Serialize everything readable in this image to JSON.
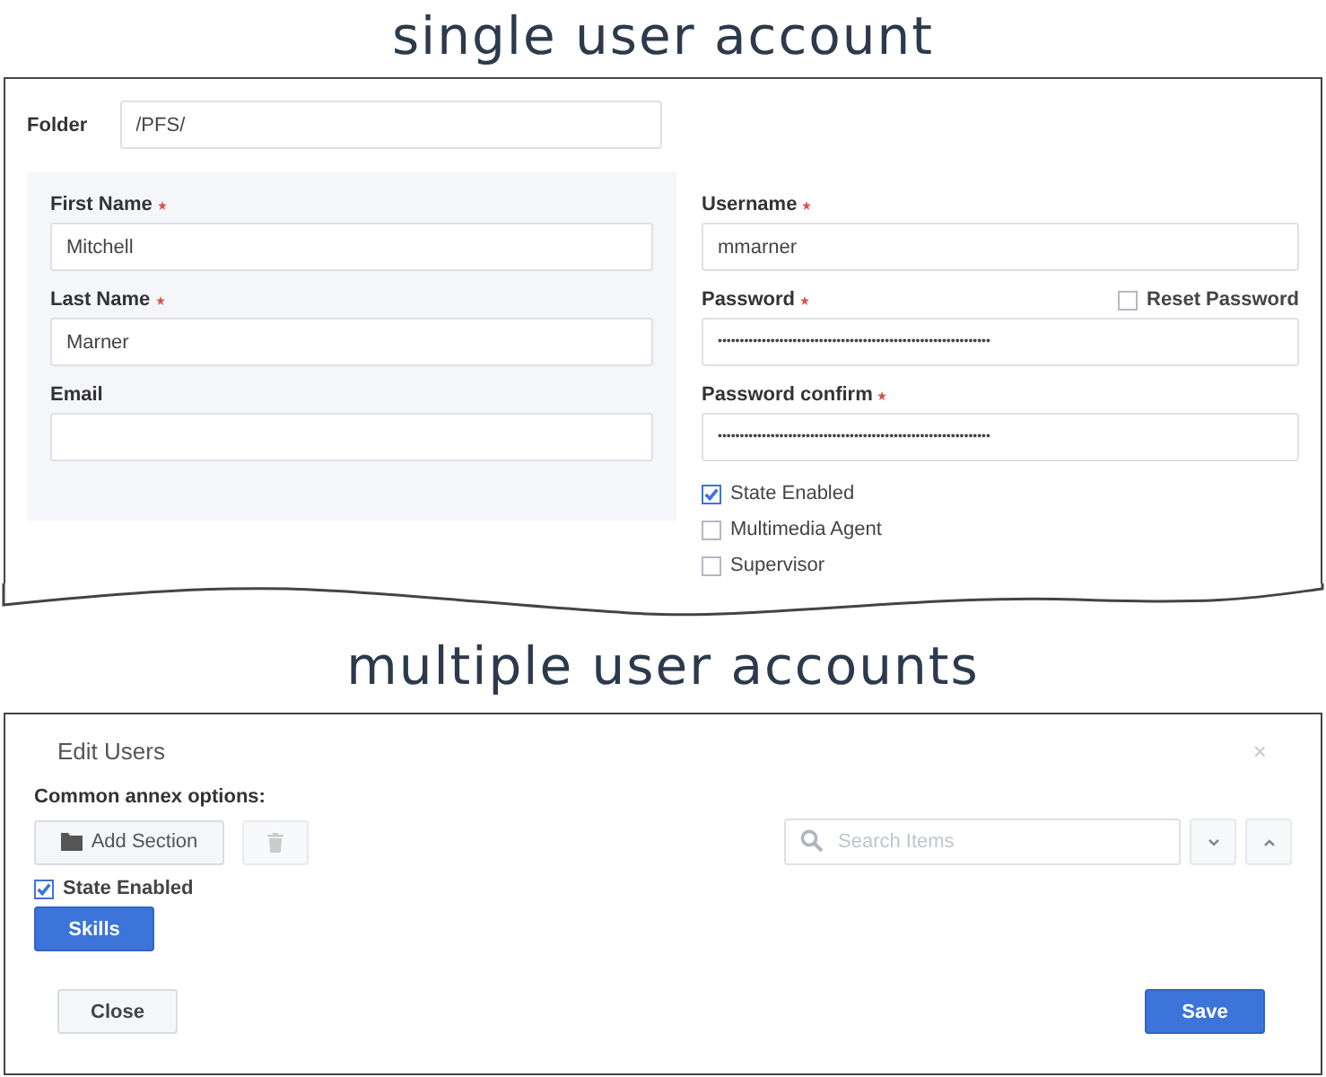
{
  "single_heading": "single user account",
  "user_form": {
    "folder_label": "Folder",
    "folder_value": "/PFS/",
    "left_fields": [
      {
        "label": "First Name",
        "required": true,
        "value": "Mitchell"
      },
      {
        "label": "Last Name",
        "required": true,
        "value": "Marner"
      },
      {
        "label": "Email",
        "required": false
      }
    ],
    "right_fields": [
      {
        "label": "Username",
        "required": true,
        "value": "mmarner"
      },
      {
        "label": "Password",
        "required": true,
        "value": "••••••••••••••••••••••••••••••••••••••••••••••••••••••••••••••",
        "reset": {
          "label": "Reset Password",
          "checked": false
        }
      },
      {
        "label": "Password confirm",
        "required": true,
        "value": "••••••••••••••••••••••••••••••••••••••••••••••••••••••••••••••"
      }
    ],
    "checkboxes": [
      {
        "label": "State Enabled",
        "checked": true
      },
      {
        "label": "Multimedia Agent",
        "checked": false
      },
      {
        "label": "Supervisor",
        "checked": false
      }
    ]
  },
  "multiple_heading": "multiple user accounts",
  "edit_dialog": {
    "title": "Edit Users",
    "close": "×",
    "section_label": "Common annex options:",
    "add_button": "Add Section",
    "search_placeholder": "Search Items",
    "checkbox": {
      "label": "State Enabled",
      "checked": true
    },
    "skills_button": "Skills",
    "footer_buttons": [
      {
        "label": "Close",
        "kind": "secondary"
      },
      {
        "label": "Save",
        "kind": "primary"
      }
    ]
  }
}
